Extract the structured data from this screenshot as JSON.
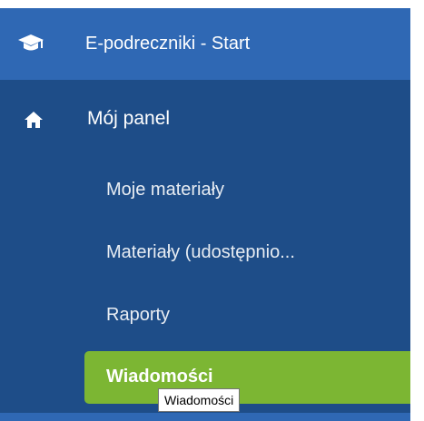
{
  "header": {
    "icon": "graduation-cap-icon",
    "title": "E-podreczniki - Start"
  },
  "sidebar": {
    "panel": {
      "icon": "home-icon",
      "label": "Mój panel"
    },
    "items": [
      {
        "label": "Moje materiały"
      },
      {
        "label": "Materiały (udostępnio..."
      },
      {
        "label": "Raporty"
      },
      {
        "label": "Wiadomości",
        "active": true
      }
    ]
  },
  "tooltip": {
    "text": "Wiadomości"
  },
  "colors": {
    "header_bg": "#2f68b4",
    "sidebar_bg": "#1e4d88",
    "active_bg": "#7cb633",
    "text": "#ffffff"
  }
}
